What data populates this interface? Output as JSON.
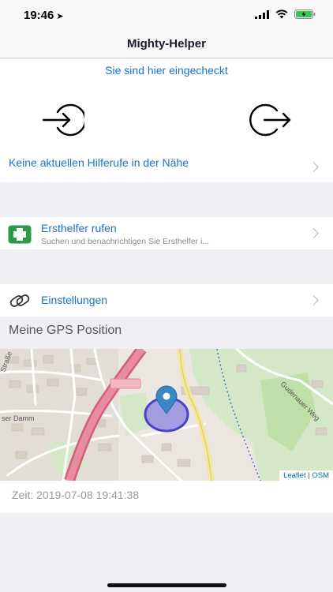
{
  "status_bar": {
    "time": "19:46"
  },
  "nav": {
    "title": "Mighty-Helper"
  },
  "checkin": {
    "status_text": "Sie sind hier eingecheckt",
    "help_text": "Keine aktuellen Hilferufe in der Nähe"
  },
  "ersthelfer": {
    "title": "Ersthelfer rufen",
    "subtitle": "Suchen und benachrichtigen Sie Ersthelfer i..."
  },
  "einstellungen": {
    "title": "Einstellungen"
  },
  "gps": {
    "header": "Meine GPS Position",
    "attribution_leaflet": "Leaflet",
    "attribution_sep": "|",
    "attribution_osm": "OSM",
    "street_labels": [
      "Straße",
      "ser Damm",
      "Gudenauer Weg"
    ],
    "time": "Zeit: 2019-07-08 19:41:38"
  },
  "colors": {
    "accent": "#1a73c8",
    "background": "#efeff4",
    "marker": "#3b86c4",
    "accuracy_circle": "#5a55d8",
    "main_road": "#e0788e",
    "green_cross": "#2a9a48"
  },
  "icons": {
    "checkin": "login-icon",
    "checkout": "logout-icon",
    "first_aid": "first-aid-icon",
    "settings": "link-icon",
    "location": "location-arrow-icon"
  }
}
